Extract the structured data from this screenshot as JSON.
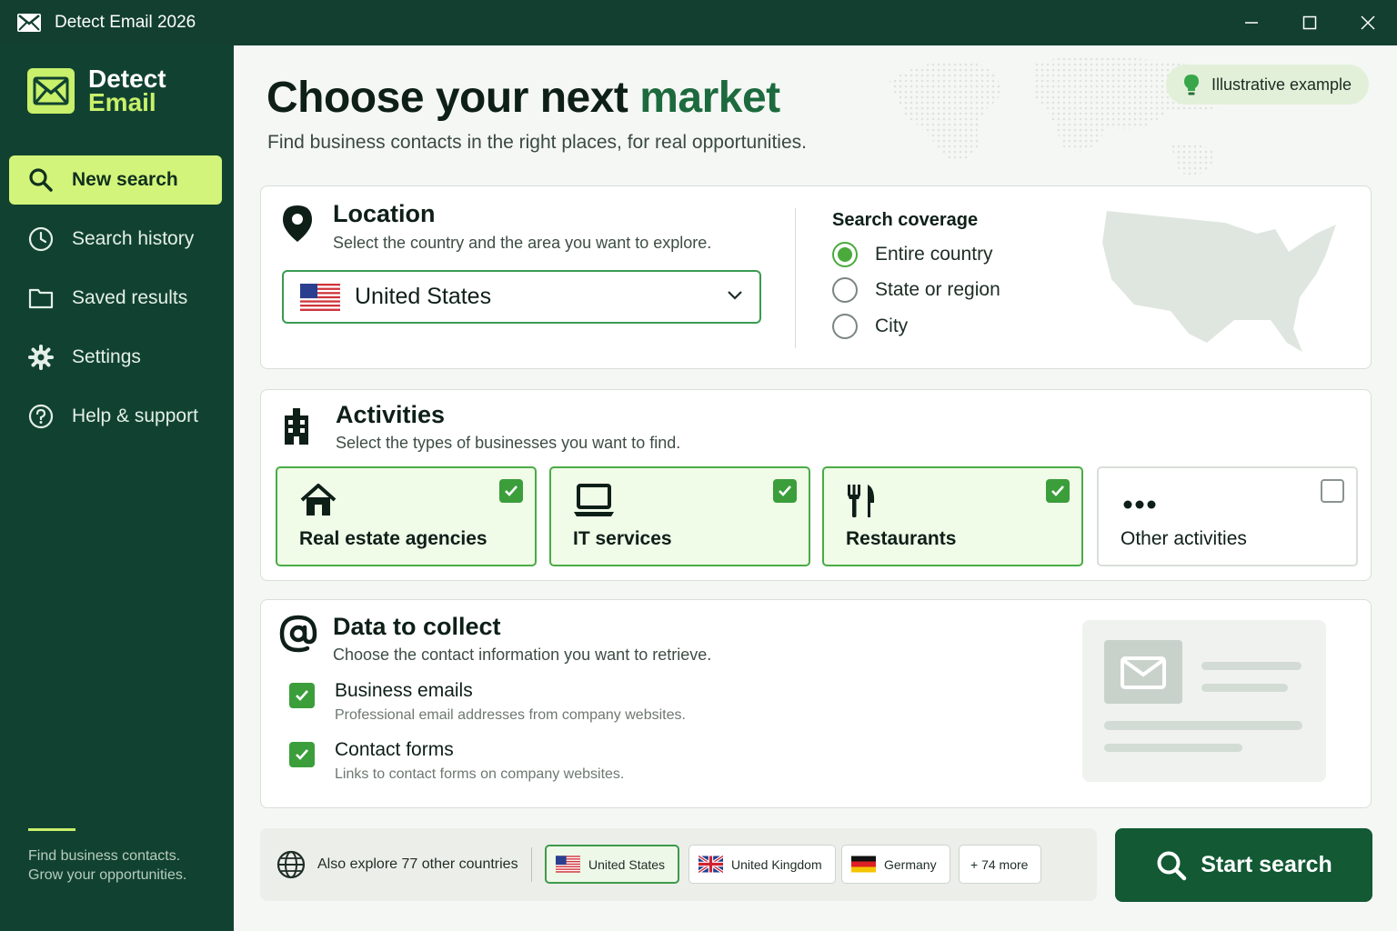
{
  "window": {
    "title": "Detect Email 2026"
  },
  "brand": {
    "line1": "Detect",
    "line2": "Email"
  },
  "nav": {
    "items": [
      {
        "label": "New search",
        "icon": "search-icon"
      },
      {
        "label": "Search history",
        "icon": "clock-icon"
      },
      {
        "label": "Saved results",
        "icon": "folder-icon"
      },
      {
        "label": "Settings",
        "icon": "gear-icon"
      },
      {
        "label": "Help & support",
        "icon": "help-icon"
      }
    ],
    "active": "New search"
  },
  "sidebar_footer": {
    "line1": "Find business contacts.",
    "line2": "Grow your opportunities."
  },
  "header": {
    "title_prefix": "Choose your next ",
    "title_highlight": "market",
    "subtitle": "Find business contacts in the right places, for real opportunities.",
    "badge": "Illustrative example"
  },
  "location": {
    "title": "Location",
    "subtitle": "Select the country and the area you want to explore.",
    "selected_country": "United States",
    "coverage_title": "Search coverage",
    "coverage_options": [
      "Entire country",
      "State or region",
      "City"
    ],
    "coverage_selected": "Entire country"
  },
  "activities": {
    "title": "Activities",
    "subtitle": "Select the types of businesses you want to find.",
    "items": [
      {
        "label": "Real estate agencies",
        "checked": true,
        "icon": "house-icon"
      },
      {
        "label": "IT services",
        "checked": true,
        "icon": "laptop-icon"
      },
      {
        "label": "Restaurants",
        "checked": true,
        "icon": "fork-knife-icon"
      },
      {
        "label": "Other activities",
        "checked": false,
        "icon": "more-icon"
      }
    ]
  },
  "data_collect": {
    "title": "Data to collect",
    "subtitle": "Choose the contact information you want to retrieve.",
    "options": [
      {
        "title": "Business emails",
        "desc": "Professional email addresses from company websites.",
        "checked": true
      },
      {
        "title": "Contact forms",
        "desc": "Links to contact forms on company websites.",
        "checked": true
      }
    ]
  },
  "explore": {
    "label": "Also explore 77 other countries",
    "chips": [
      "United States",
      "United Kingdom",
      "Germany",
      "+ 74 more"
    ],
    "selected": "United States"
  },
  "start_button": {
    "label": "Start search"
  },
  "colors": {
    "sidebar": "#114231",
    "accent": "#c8f06a",
    "primary_button": "#125934",
    "check": "#3b9e3b"
  }
}
